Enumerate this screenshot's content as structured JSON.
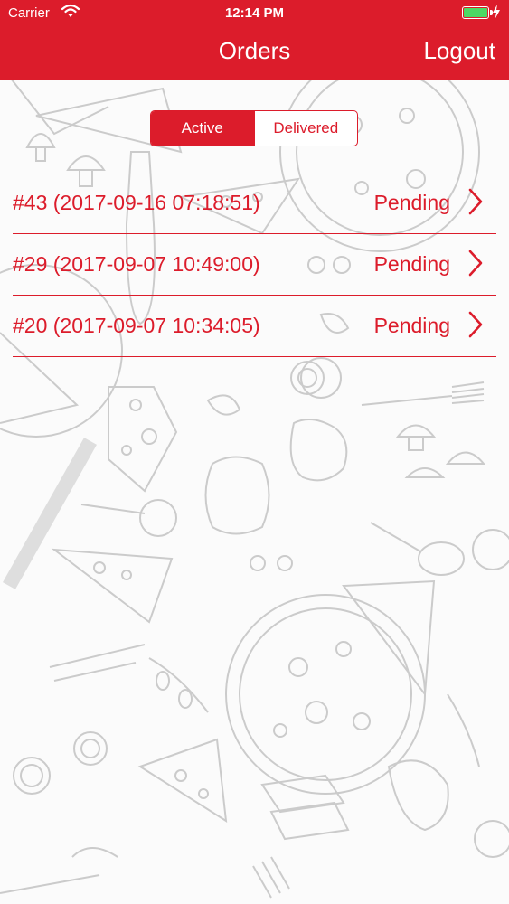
{
  "status_bar": {
    "carrier": "Carrier",
    "time": "12:14 PM"
  },
  "nav": {
    "title": "Orders",
    "logout_label": "Logout"
  },
  "segment": {
    "active_label": "Active",
    "delivered_label": "Delivered",
    "selected": "Active"
  },
  "orders": [
    {
      "label": "#43 (2017-09-16 07:18:51)",
      "status": "Pending"
    },
    {
      "label": "#29 (2017-09-07 10:49:00)",
      "status": "Pending"
    },
    {
      "label": "#20 (2017-09-07 10:34:05)",
      "status": "Pending"
    }
  ],
  "colors": {
    "brand": "#dc1c2b",
    "battery": "#4cd964",
    "background": "#fbfbfb",
    "doodle": "#c9c9c9"
  },
  "icons": [
    "wifi-icon",
    "battery-icon",
    "charging-bolt-icon",
    "chevron-right-icon"
  ]
}
